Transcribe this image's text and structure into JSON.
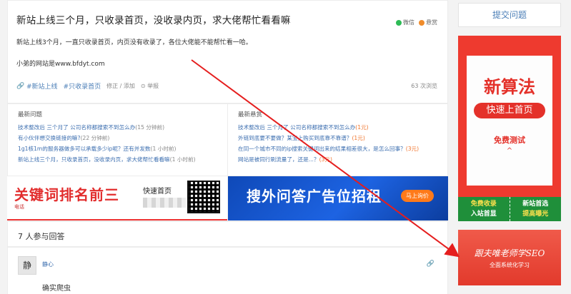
{
  "question": {
    "title": "新站上线三个月，只收录首页，没收录内页，求大佬帮忙看看嘛",
    "share_wechat": "微信",
    "share_reward": "悬赏",
    "body_line1": "新站上线3个月，一直只收录首页，内页没有收录了，各位大佬能不能帮忙看一哈。",
    "body_line2": "小弟的网站是www.bfdyt.com",
    "tags": [
      "#新站上线",
      "#只收录首页"
    ],
    "action_edit": "修正 / 添加",
    "action_report": "举报",
    "views": "63 次浏览"
  },
  "latest_questions": {
    "title": "最新问题",
    "items": [
      {
        "text": "技术整改后 三个月了 公司名称都搜索不到怎么办",
        "meta": "(15 分钟前)"
      },
      {
        "text": "有小伙伴想交换链接的嘛?",
        "meta": "(22 分钟前)"
      },
      {
        "text": "1g1核1m的服务器做多可以承载多少ip呢？还有并发数",
        "meta": "(1 小时前)"
      },
      {
        "text": "新站上线三个月，只收录首页，没收录内页，求大佬帮忙看看嘛",
        "meta": "(1 小时前)"
      }
    ]
  },
  "latest_rewards": {
    "title": "最新悬赏",
    "items": [
      {
        "text": "技术整改后 三个月了 公司名称都搜索不到怎么办",
        "reward": "(1元)"
      },
      {
        "text": "外链到底要不要做？某宝上购买到底靠不靠谱？",
        "reward": "(1元)"
      },
      {
        "text": "在同一个城市不同的ip搜索关键词出来的结果相差很大，是怎么回事？",
        "reward": "(3元)"
      },
      {
        "text": "网站是被同行刷流量了，还是...？",
        "reward": "(3元)"
      }
    ]
  },
  "banner_left": {
    "headline": "关键词排名前三",
    "side": "快速首页",
    "sub": "电话"
  },
  "banner_right": {
    "headline": "搜外问答广告位招租",
    "button": "马上询价"
  },
  "answers": {
    "count_label": "7 人参与回答",
    "first": {
      "avatar": "静",
      "user": "静心",
      "text": "确实爬虫"
    }
  },
  "sidebar": {
    "submit_button": "提交问题",
    "ad1_title": "新算法",
    "ad1_pill": "快速上首页",
    "ad1_sub": "免费测试",
    "ad1_arrow": "^",
    "ad2_col1_line1": "免费收录",
    "ad2_col1_line2": "入站首显",
    "ad2_col2_line1": "新站首选",
    "ad2_col2_line2": "提高曝光",
    "ad3_title": "跟夫唯老师学SEO",
    "ad3_sub": "全面系统化学习"
  },
  "colors": {
    "link": "#3d6fb0",
    "reward": "#f0732b",
    "arrow": "#e51e1e"
  }
}
